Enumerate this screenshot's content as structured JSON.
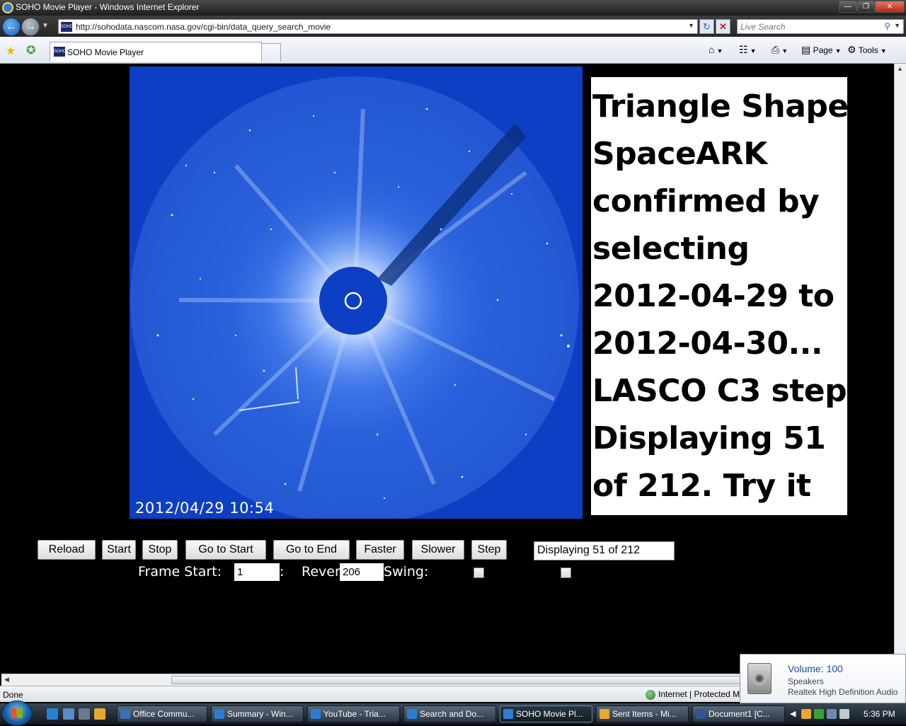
{
  "window": {
    "title": "SOHO Movie Player - Windows Internet Explorer"
  },
  "address": {
    "url": "http://sohodata.nascom.nasa.gov/cgi-bin/data_query_search_movie",
    "search_placeholder": "Live Search"
  },
  "tab": {
    "label": "SOHO Movie Player",
    "favicon_text": "SOHO"
  },
  "commands": {
    "page": "Page",
    "tools": "Tools"
  },
  "image": {
    "timestamp": "2012/04/29  10:54"
  },
  "note": {
    "lines": [
      "Triangle Shape",
      "SpaceARK",
      "confirmed by",
      "selecting",
      "2012-04-29 to",
      "2012-04-30...",
      "LASCO C3 step",
      "Displaying 51",
      "of 212. Try it"
    ]
  },
  "controls": {
    "buttons": [
      "Reload",
      "Start",
      "Stop",
      "Go to Start",
      "Go to End",
      "Faster",
      "Slower",
      "Step"
    ],
    "status": "Displaying 51 of 212",
    "frame_start_label": "Frame Start:",
    "frame_start_value": "1",
    "frame_end_fragment": ":",
    "reverse_label": "Rever",
    "reverse_value": "206",
    "swing_label": "Swing:"
  },
  "statusbar": {
    "left": "Done",
    "zone": "Internet | Protected M"
  },
  "volume": {
    "title": "Volume: 100",
    "device": "Speakers",
    "driver": "Realtek High Definition Audio"
  },
  "taskbar": {
    "buttons": [
      {
        "label": "Office Commu...",
        "color": "#3b6fb6"
      },
      {
        "label": "Summary - Win...",
        "color": "#2a7fd4"
      },
      {
        "label": "YouTube - Tria...",
        "color": "#2a7fd4"
      },
      {
        "label": "Search and Do...",
        "color": "#2a7fd4"
      },
      {
        "label": "SOHO Movie Pl...",
        "color": "#2a7fd4",
        "active": true
      },
      {
        "label": "Sent Items - Mi...",
        "color": "#e8a830"
      },
      {
        "label": "Document1 [C...",
        "color": "#2b5797"
      }
    ],
    "clock": "5:36 PM"
  }
}
